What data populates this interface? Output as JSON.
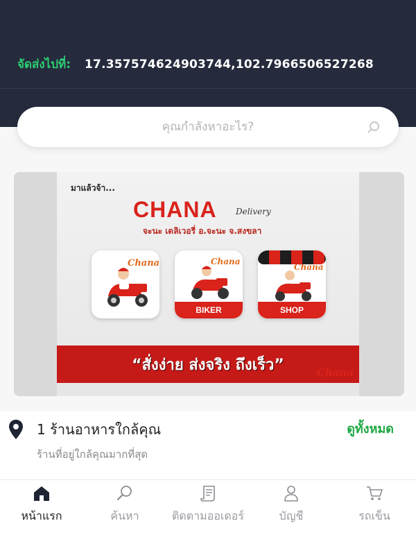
{
  "header": {
    "deliver_label": "จัดส่งไปที่:",
    "coordinates": "17.357574624903744,102.7966506527268"
  },
  "search": {
    "placeholder": "คุณกำลังหาอะไร?"
  },
  "banner": {
    "top_text": "มาแล้วจ้า...",
    "brand": "CHANA",
    "brand_sub": "Delivery",
    "subtitle": "จะนะ เดลิเวอรี่ อ.จะนะ จ.สงขลา",
    "biker_label": "BIKER",
    "shop_label": "SHOP",
    "slogan": "“สั่งง่าย ส่งจริง ถึงเร็ว”",
    "watermark": "Chana"
  },
  "nearby": {
    "title": "1 ร้านอาหารใกล้คุณ",
    "subtitle": "ร้านที่อยู่ใกล้คุณมากที่สุด",
    "view_all": "ดูทั้งหมด"
  },
  "tabs": [
    {
      "label": "หน้าแรก",
      "icon": "home-icon",
      "active": true
    },
    {
      "label": "ค้นหา",
      "icon": "search-icon",
      "active": false
    },
    {
      "label": "ติดตามออเดอร์",
      "icon": "receipt-icon",
      "active": false
    },
    {
      "label": "บัญชี",
      "icon": "user-icon",
      "active": false
    },
    {
      "label": "รถเข็น",
      "icon": "cart-icon",
      "active": false
    }
  ],
  "colors": {
    "header_bg": "#252b3d",
    "accent_green": "#2ecc71",
    "brand_red": "#d9231b"
  }
}
